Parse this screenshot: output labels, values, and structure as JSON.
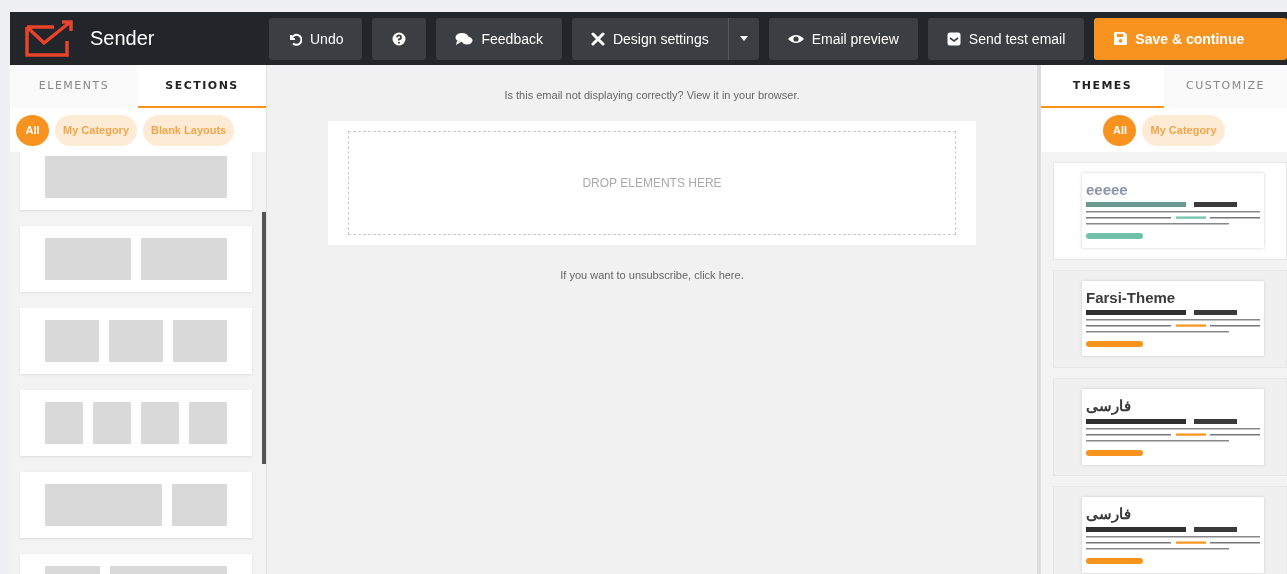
{
  "app": {
    "name": "Sender"
  },
  "toolbar": {
    "buttons": [
      {
        "kind": "undo",
        "label": "Undo"
      },
      {
        "kind": "help"
      },
      {
        "kind": "feedback",
        "label": "Feedback"
      },
      {
        "kind": "design",
        "label": "Design settings"
      },
      {
        "kind": "preview",
        "label": "Email preview"
      },
      {
        "kind": "test",
        "label": "Send test email"
      },
      {
        "kind": "save",
        "label": "Save & continue"
      }
    ]
  },
  "left_panel": {
    "tabs": [
      {
        "label": "ELEMENTS",
        "selected": false
      },
      {
        "label": "SECTIONS",
        "selected": true
      }
    ],
    "filters": [
      {
        "label": "All",
        "selected": true
      },
      {
        "label": "My Category",
        "selected": false
      },
      {
        "label": "Blank Layouts",
        "selected": false
      }
    ],
    "sections": [
      {
        "kind": "full"
      },
      {
        "kind": "halves"
      },
      {
        "kind": "thirds"
      },
      {
        "kind": "quarters"
      },
      {
        "kind": "wide-narrow"
      },
      {
        "kind": "narrow-wide"
      }
    ]
  },
  "canvas": {
    "header_note": "Is this email not displaying correctly? View it in your browser.",
    "drop_zone": "DROP ELEMENTS HERE",
    "footer_note": "If you want to unsubscribe, click here."
  },
  "right_panel": {
    "tabs": [
      {
        "label": "THEMES",
        "selected": true
      },
      {
        "label": "CUSTOMIZE",
        "selected": false
      }
    ],
    "filters": [
      {
        "label": "All",
        "selected": true
      },
      {
        "label": "My Category",
        "selected": false
      }
    ],
    "themes": [
      {
        "title": "eeeee",
        "color": "#6fc2a8",
        "selected": true
      },
      {
        "title": "Farsi-Theme",
        "color": "#f7941d",
        "selected": false
      },
      {
        "title": "فارسی",
        "color": "#f7941d",
        "selected": false
      },
      {
        "title": "فارسی",
        "color": "#f7941d",
        "selected": false
      }
    ]
  }
}
